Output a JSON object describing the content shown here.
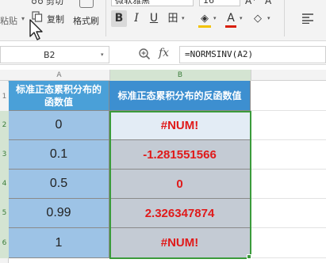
{
  "ribbon": {
    "paste_label": "粘贴",
    "cut_label": "剪切",
    "copy_label": "复制",
    "painter_label": "格式刷",
    "font_name": "微软雅黑",
    "font_size": "16",
    "grow_label": "A⁺",
    "shrink_label": "A⁻",
    "bold_label": "B",
    "italic_label": "I",
    "underline_label": "U",
    "border_label": "田",
    "fill_label": "◈",
    "font_color_label": "A",
    "clear_label": "◇",
    "fill_color": "#f2c200",
    "font_color": "#d81e06"
  },
  "formula_bar": {
    "name_box": "B2",
    "fx_label": "fx",
    "formula": "=NORMSINV(A2)"
  },
  "columns": {
    "a": "A",
    "b": "B"
  },
  "rows": [
    "1",
    "2",
    "3",
    "4",
    "5",
    "6"
  ],
  "table": {
    "header_a": "标准正态累积分布的函数值",
    "header_b": "标准正态累积分布的反函数值",
    "values_a": [
      "0",
      "0.1",
      "0.5",
      "0.99",
      "1"
    ],
    "values_b": [
      "#NUM!",
      "-1.281551566",
      "0",
      "2.326347874",
      "#NUM!"
    ]
  }
}
